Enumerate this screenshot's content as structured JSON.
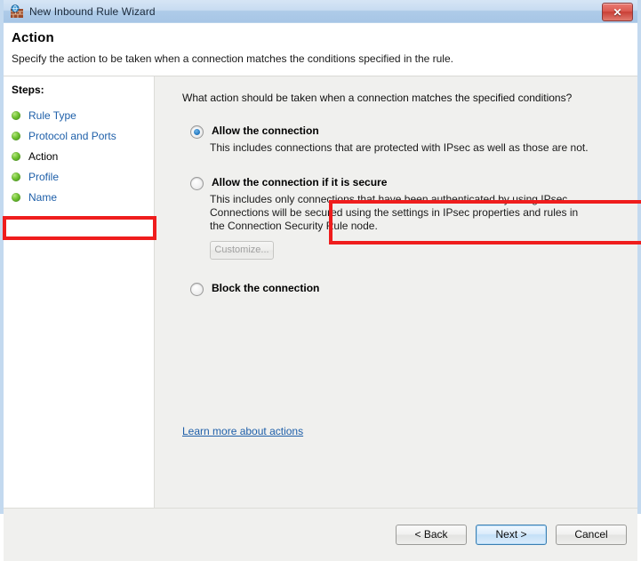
{
  "window": {
    "title": "New Inbound Rule Wizard",
    "icon": "firewall-globe-icon",
    "close_label": "✕"
  },
  "header": {
    "title": "Action",
    "subtitle": "Specify the action to be taken when a connection matches the conditions specified in the rule."
  },
  "sidebar": {
    "label": "Steps:",
    "items": [
      {
        "label": "Rule Type",
        "current": false
      },
      {
        "label": "Protocol and Ports",
        "current": false
      },
      {
        "label": "Action",
        "current": true
      },
      {
        "label": "Profile",
        "current": false
      },
      {
        "label": "Name",
        "current": false
      }
    ]
  },
  "main": {
    "prompt": "What action should be taken when a connection matches the specified conditions?",
    "options": [
      {
        "title": "Allow the connection",
        "description": "This includes connections that are protected with IPsec as well as those are not.",
        "selected": true
      },
      {
        "title": "Allow the connection if it is secure",
        "description": "This includes only connections that have been authenticated by using IPsec.  Connections will be secured using the settings in IPsec properties and rules in the Connection Security Rule node.",
        "selected": false,
        "button": "Customize..."
      },
      {
        "title": "Block the connection",
        "description": "",
        "selected": false
      }
    ],
    "learn_more": "Learn more about actions"
  },
  "footer": {
    "back": "< Back",
    "next": "Next >",
    "cancel": "Cancel"
  },
  "annotations": {
    "sidebar_highlight": "Action",
    "option_highlight": "Allow the connection",
    "color": "#ef1d1d"
  }
}
